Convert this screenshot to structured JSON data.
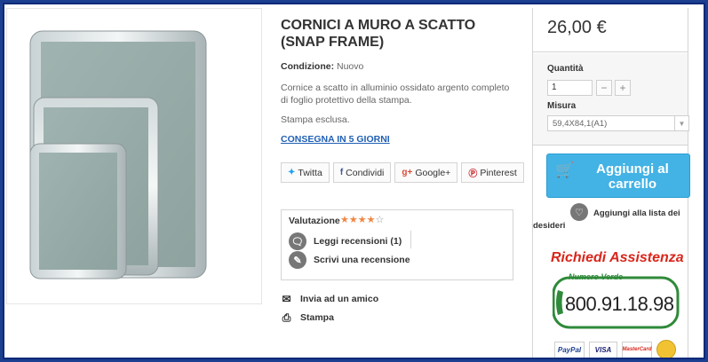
{
  "product": {
    "title": "CORNICI A MURO A SCATTO (SNAP FRAME)",
    "condition_label": "Condizione:",
    "condition_value": "Nuovo",
    "description": "Cornice a scatto in alluminio ossidato argento completo di foglio protettivo della stampa.",
    "note": "Stampa esclusa.",
    "delivery_link": "CONSEGNA IN 5 GIORNI"
  },
  "social": {
    "twitter": "Twitta",
    "facebook": "Condividi",
    "google": "Google+",
    "pinterest": "Pinterest"
  },
  "reviews": {
    "label": "Valutazione",
    "rating": 4,
    "max": 5,
    "read_label": "Leggi recensioni (1)",
    "write_label": "Scrivi una recensione"
  },
  "links": {
    "send_friend": "Invia ad un amico",
    "print": "Stampa"
  },
  "buy": {
    "price": "26,00 €",
    "qty_label": "Quantità",
    "qty_value": "1",
    "size_label": "Misura",
    "size_value": "59,4X84,1(A1)",
    "cart_label": "Aggiungi al carrello",
    "wishlist_label": "Aggiungi alla lista dei desideri"
  },
  "assist": {
    "title": "Richiedi Assistenza",
    "green_label": "Numero Verde",
    "phone": "800.91.18.98"
  },
  "payments": [
    "PayPal",
    "VISA",
    "MasterCard"
  ],
  "colors": {
    "accent": "#43b2e4",
    "star": "#ef8743",
    "link": "#1f5fb5",
    "assist_red": "#d9261c",
    "border_blue": "#1d3f8f"
  }
}
